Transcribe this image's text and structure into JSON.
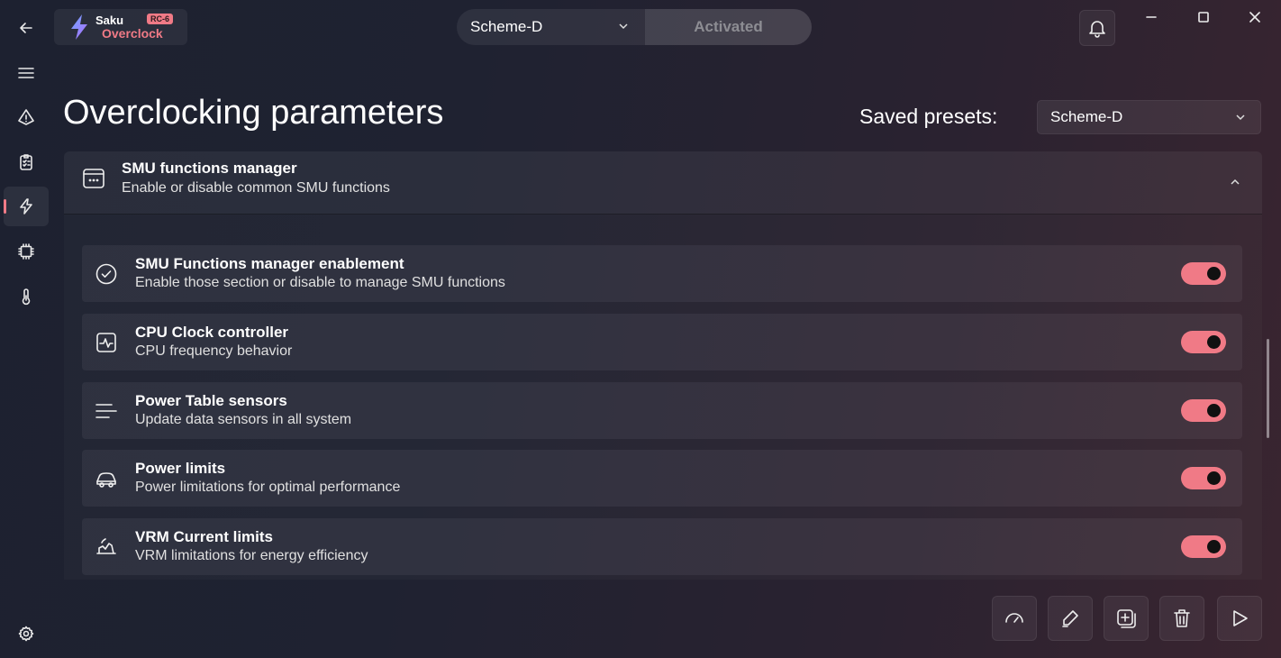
{
  "app": {
    "name_top": "Saku",
    "name_bottom": "Overclock",
    "version_badge": "RC-6",
    "accent_color": "#f07a86"
  },
  "nav": {
    "items": [
      {
        "icon": "back-arrow-icon"
      },
      {
        "icon": "hamburger-menu-icon"
      },
      {
        "icon": "info-triangle-icon"
      },
      {
        "icon": "clipboard-checklist-icon"
      },
      {
        "icon": "lightning-icon",
        "active": true
      },
      {
        "icon": "cpu-chip-icon"
      },
      {
        "icon": "thermometer-icon"
      },
      {
        "icon": "settings-gear-icon"
      }
    ]
  },
  "header": {
    "scheme_value": "Scheme-D",
    "activated_label": "Activated"
  },
  "page": {
    "title": "Overclocking parameters",
    "presets_label": "Saved presets:",
    "presets_value": "Scheme-D"
  },
  "section": {
    "title": "SMU functions manager",
    "subtitle": "Enable or disable common SMU functions",
    "expanded": true
  },
  "rows": [
    {
      "title": "SMU Functions manager enablement",
      "subtitle": "Enable those section or disable to manage SMU functions",
      "icon": "checkmark-circle-icon",
      "enabled": true
    },
    {
      "title": "CPU Clock controller",
      "subtitle": "CPU frequency behavior",
      "icon": "pulse-monitor-icon",
      "enabled": true
    },
    {
      "title": "Power Table sensors",
      "subtitle": "Update data sensors in all system",
      "icon": "lines-list-icon",
      "enabled": true
    },
    {
      "title": "Power limits",
      "subtitle": "Power limitations for optimal performance",
      "icon": "power-vehicle-icon",
      "enabled": true
    },
    {
      "title": "VRM Current limits",
      "subtitle": "VRM limitations for energy efficiency",
      "icon": "vrm-current-icon",
      "enabled": true
    }
  ],
  "toolbar": [
    {
      "icon": "speedometer-icon"
    },
    {
      "icon": "edit-pen-icon"
    },
    {
      "icon": "add-square-icon"
    },
    {
      "icon": "delete-trash-icon"
    },
    {
      "icon": "play-apply-icon"
    }
  ]
}
